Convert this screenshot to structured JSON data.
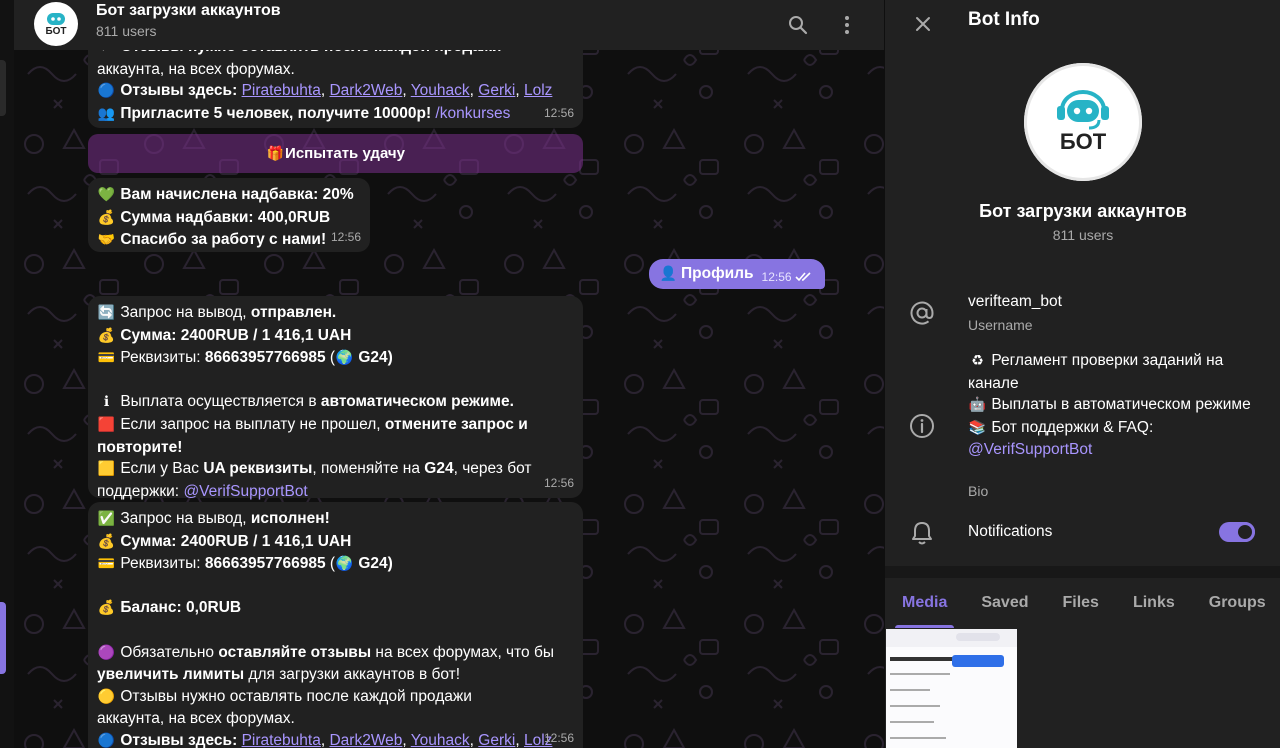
{
  "colors": {
    "accent": "#8774e1",
    "panel_bg": "#212121",
    "chat_bg": "#0f0f0f",
    "link": "#a996ff",
    "muted": "#aaaaaa"
  },
  "chat": {
    "title": "Бот загрузки аккаунтов",
    "subtitle": "811 users",
    "avatar_text": "БОТ",
    "icons": {
      "search": "search-icon",
      "menu": "more-vertical-icon"
    },
    "msg1": {
      "line1_emoji": "⚡",
      "line1": "Отзывы нужно оставлять после каждой продажи",
      "line2": "аккаунта, на всех форумах.",
      "line3_emoji": "🔵",
      "line3_label": "Отзывы здесь:",
      "links": [
        "Piratebuhta",
        "Dark2Web",
        "Youhack",
        "Gerki",
        "Lolz"
      ],
      "line4_emoji": "👥",
      "line4": "Пригласите 5 человек, получите 10000р!",
      "command": "/konkurses",
      "time": "12:56"
    },
    "inline_button": {
      "emoji": "🎁",
      "label": "Испытать удачу"
    },
    "msg2": {
      "l1_emoji": "💚",
      "l1": "Вам начислена надбавка: 20%",
      "l2_emoji": "💰",
      "l2": "Сумма надбавки: 400,0RUB",
      "l3_emoji": "🤝",
      "l3": "Спасибо за работу с нами!",
      "time": "12:56"
    },
    "outgoing": {
      "emoji": "👤",
      "label": "Профиль",
      "time": "12:56",
      "status": "read"
    },
    "msg3": {
      "l1_emoji": "🔄",
      "l1a": "Запрос на вывод, ",
      "l1b": "отправлен.",
      "l2_emoji": "💰",
      "l2": "Сумма: 2400RUB  / 1 416,1 UAH",
      "l3_emoji": "💳",
      "l3a": "Реквизиты: ",
      "l3b": "86663957766985",
      "l3c": " (",
      "l3_globe": "🌍",
      "l3d": " G24)",
      "l4_emoji": "ℹ",
      "l4a": "Выплата осуществляется в ",
      "l4b": "автоматическом режиме.",
      "l5_emoji": "🟥",
      "l5a": "Если запрос на выплату не прошел, ",
      "l5b": "отмените запрос и",
      "l6": "повторите!",
      "l7_emoji": "🟨",
      "l7a": "Если у Вас ",
      "l7b": "UA реквизиты",
      "l7c": ", поменяйте на ",
      "l7d": "G24",
      "l7e": ", через бот",
      "l8": "поддержки: ",
      "mention": "@VerifSupportBot",
      "time": "12:56"
    },
    "msg4": {
      "l1_emoji": "✅",
      "l1a": "Запрос на вывод, ",
      "l1b": "исполнен!",
      "l2_emoji": "💰",
      "l2": "Сумма: 2400RUB  / 1 416,1 UAH",
      "l3_emoji": "💳",
      "l3a": "Реквизиты: ",
      "l3b": "86663957766985",
      "l3c": " (",
      "l3_globe": "🌍",
      "l3d": " G24)",
      "l4_emoji": "💰",
      "l4": "Баланс: 0,0RUB",
      "l5_emoji": "🟣",
      "l5a": "Обязательно ",
      "l5b": "оставляйте отзывы",
      "l5c": " на всех форумах, что бы",
      "l6a": "увеличить лимиты",
      "l6b": " для загрузки аккаунтов в бот!",
      "l7_emoji": "🟡",
      "l7": "Отзывы нужно оставлять после каждой продажи",
      "l8": "аккаунта, на всех форумах.",
      "l9_emoji": "🔵",
      "l9_label": "Отзывы здесь:",
      "links": [
        "Piratebuhta",
        "Dark2Web",
        "Youhack",
        "Gerki",
        "Lolz"
      ],
      "time": "12:56"
    }
  },
  "panel": {
    "title": "Bot Info",
    "avatar_text": "БОТ",
    "name": "Бот загрузки аккаунтов",
    "subtitle": "811 users",
    "username": "verifteam_bot",
    "username_label": "Username",
    "bio_l1_emoji": "♻",
    "bio_l1": "Регламент проверки заданий на канале",
    "bio_l2_emoji": "🤖",
    "bio_l2": "Выплаты в автоматическом режиме",
    "bio_l3_emoji": "📚",
    "bio_l3": "Бот поддержки & FAQ:",
    "bio_mention": "@VerifSupportBot",
    "bio_label": "Bio",
    "notifications_label": "Notifications",
    "notifications_on": true,
    "tabs": [
      "Media",
      "Saved",
      "Files",
      "Links",
      "Groups"
    ],
    "active_tab": "Media"
  }
}
